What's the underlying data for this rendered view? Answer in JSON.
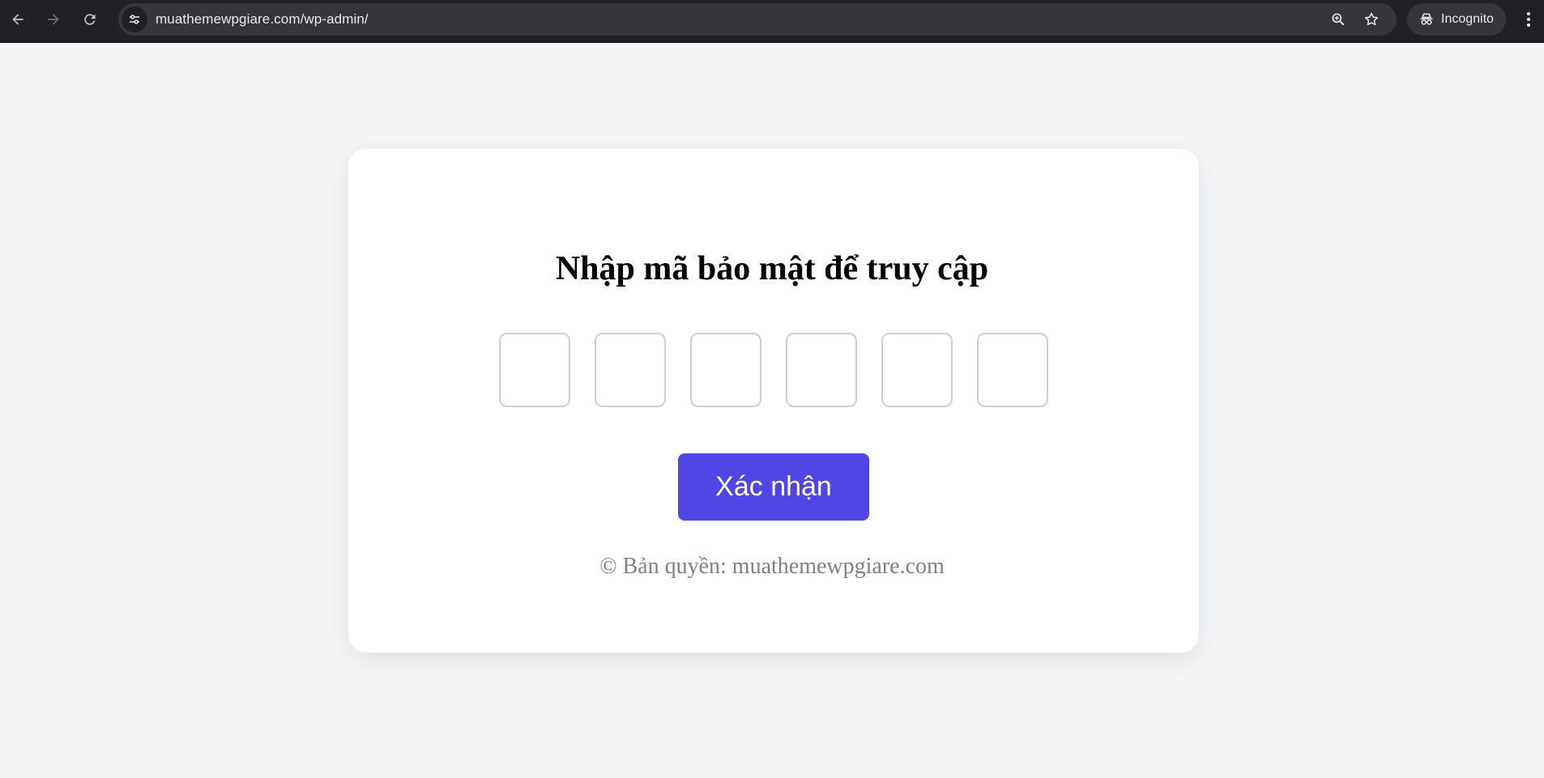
{
  "browser": {
    "url": "muathemewpgiare.com/wp-admin/",
    "incognito_label": "Incognito",
    "icons": [
      "back-arrow-icon",
      "forward-arrow-icon",
      "reload-icon",
      "site-info-icon",
      "zoom-icon",
      "bookmark-star-icon",
      "incognito-icon",
      "kebab-menu-icon"
    ]
  },
  "card": {
    "title": "Nhập mã bảo mật để truy cập",
    "otp_count": 6,
    "submit_label": "Xác nhận",
    "copyright": "© Bản quyền: muathemewpgiare.com"
  },
  "colors": {
    "accent": "#4f46e5",
    "page_bg": "#f3f4f6",
    "card_bg": "#ffffff",
    "copyright_text": "#808080"
  }
}
